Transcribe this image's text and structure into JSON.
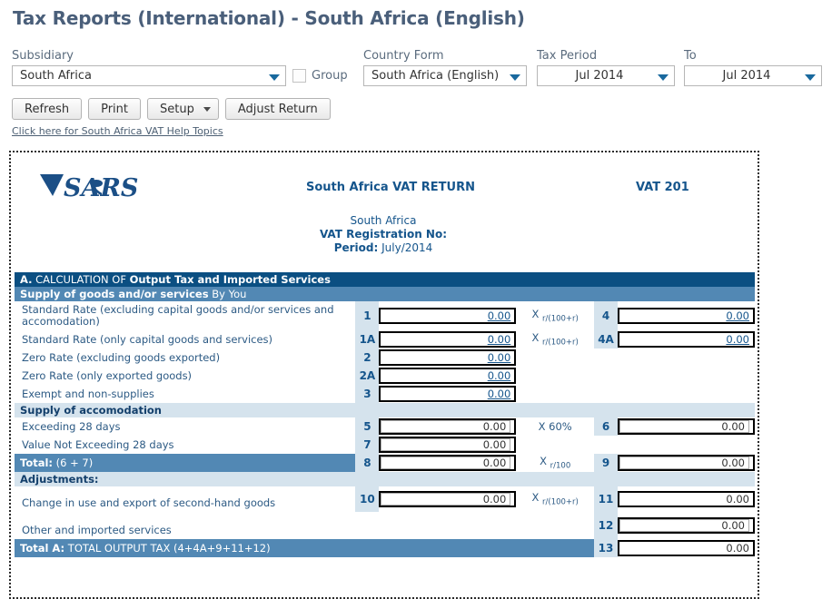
{
  "page": {
    "title": "Tax Reports (International) - South Africa (English)"
  },
  "filters": {
    "subsidiary": {
      "label": "Subsidiary",
      "value": "South Africa"
    },
    "group": {
      "label": "Group",
      "checked": false
    },
    "country_form": {
      "label": "Country Form",
      "value": "South Africa (English)"
    },
    "tax_period": {
      "label": "Tax Period",
      "value": "Jul 2014"
    },
    "to": {
      "label": "To",
      "value": "Jul 2014"
    }
  },
  "toolbar": {
    "refresh": "Refresh",
    "print": "Print",
    "setup": "Setup",
    "adjust_return": "Adjust Return"
  },
  "help_link": "Click here for South Africa VAT Help Topics",
  "form": {
    "logo_alt": "SARS",
    "title": "South Africa VAT RETURN",
    "code": "VAT 201",
    "country": "South Africa",
    "registration_label": "VAT Registration No:",
    "registration_value": "",
    "period_label": "Period:",
    "period_value": "July/2014",
    "section_a": {
      "prefix": "A.",
      "text": " CALCULATION OF ",
      "bold": "Output Tax and Imported Services"
    },
    "supply_header": {
      "bold": "Supply of goods and/or services",
      "rest": " By You"
    },
    "accommodation_header": "Supply of accomodation",
    "adjustments_header": "Adjustments:",
    "total_row": {
      "bold": "Total:",
      "rest": " (6 + 7)"
    },
    "total_a_row": {
      "bold": "Total A:",
      "rest": " TOTAL OUTPUT TAX (4+4A+9+11+12)"
    },
    "mult_r100r": "r/(100+r)",
    "mult_r100": "r/100",
    "mult_60": "X 60%",
    "mult_x": "X",
    "rows": [
      {
        "label": "Standard Rate (excluding capital goods and/or services and accomodation)",
        "num": "1",
        "value": "0.00",
        "mult": "r/(100+r)",
        "num2": "4",
        "value2": "0.00"
      },
      {
        "label": "Standard Rate (only capital goods and services)",
        "num": "1A",
        "value": "0.00",
        "mult": "r/(100+r)",
        "num2": "4A",
        "value2": "0.00"
      },
      {
        "label": "Zero Rate (excluding goods exported)",
        "num": "2",
        "value": "0.00",
        "mult": "",
        "num2": "",
        "value2": ""
      },
      {
        "label": "Zero Rate (only exported goods)",
        "num": "2A",
        "value": "0.00",
        "mult": "",
        "num2": "",
        "value2": ""
      },
      {
        "label": "Exempt and non-supplies",
        "num": "3",
        "value": "0.00",
        "mult": "",
        "num2": "",
        "value2": ""
      },
      {
        "label": "Exceeding 28 days",
        "num": "5",
        "value": "0.00",
        "mult": "X 60%",
        "num2": "6",
        "value2": "0.00"
      },
      {
        "label": "Value Not Exceeding 28 days",
        "num": "7",
        "value": "0.00",
        "mult": "",
        "num2": "",
        "value2": ""
      },
      {
        "label": "Total: (6 + 7)",
        "num": "8",
        "value": "0.00",
        "mult": "r/100",
        "num2": "9",
        "value2": "0.00"
      },
      {
        "label": "Change in use and export of second-hand goods",
        "num": "10",
        "value": "0.00",
        "mult": "r/(100+r)",
        "num2": "11",
        "value2": "0.00"
      },
      {
        "label": "Other and imported services",
        "num": "",
        "value": "",
        "mult": "",
        "num2": "12",
        "value2": "0.00"
      },
      {
        "label": "Total A: TOTAL OUTPUT TAX (4+4A+9+11+12)",
        "num": "",
        "value": "",
        "mult": "",
        "num2": "13",
        "value2": "0.00"
      }
    ]
  },
  "colors": {
    "header_dark": "#0b4f82",
    "header_mid": "#5288b4",
    "header_light": "#d5e3ed",
    "text_blue": "#2c5a84",
    "link_blue": "#15558c",
    "title_gray": "#4a5f7a"
  }
}
